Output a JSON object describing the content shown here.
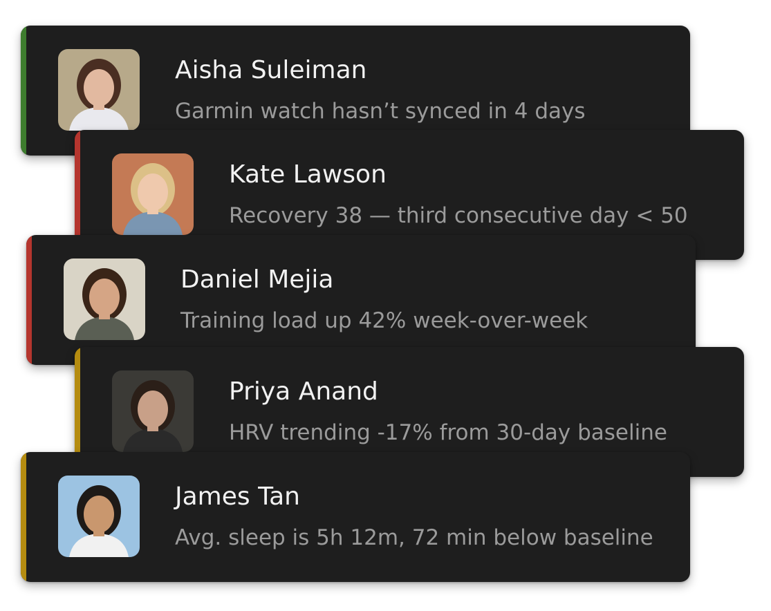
{
  "alerts": [
    {
      "name": "Aisha Suleiman",
      "message": "Garmin watch hasn’t synced in 4 days",
      "accent": "#3e7d2e",
      "avatar_icon": "person-photo-icon",
      "avatar_colors": {
        "bg": "#b7a98a",
        "skin": "#e2b9a0",
        "hair": "#4a2e22",
        "shirt": "#e9e9ee"
      }
    },
    {
      "name": "Kate Lawson",
      "message": "Recovery 38 — third consecutive day < 50",
      "accent": "#b5352e",
      "avatar_icon": "person-photo-icon",
      "avatar_colors": {
        "bg": "#c47a55",
        "skin": "#efc9ad",
        "hair": "#dcc087",
        "shirt": "#7a96b2"
      }
    },
    {
      "name": "Daniel Mejia",
      "message": "Training load up 42% week-over-week",
      "accent": "#b5352e",
      "avatar_icon": "person-photo-icon",
      "avatar_colors": {
        "bg": "#d9d4c6",
        "skin": "#d5a585",
        "hair": "#3a2518",
        "shirt": "#5a5f54"
      }
    },
    {
      "name": "Priya Anand",
      "message": "HRV trending -17% from 30-day baseline",
      "accent": "#b58c10",
      "avatar_icon": "person-photo-icon",
      "avatar_colors": {
        "bg": "#3b3a36",
        "skin": "#c8a088",
        "hair": "#2b1f18",
        "shirt": "#2a2a2a"
      }
    },
    {
      "name": "James Tan",
      "message": "Avg. sleep is 5h 12m, 72 min below baseline",
      "accent": "#b58c10",
      "avatar_icon": "person-photo-icon",
      "avatar_colors": {
        "bg": "#9cc3e2",
        "skin": "#c9976e",
        "hair": "#1e1a17",
        "shirt": "#f1f1f1"
      }
    }
  ]
}
